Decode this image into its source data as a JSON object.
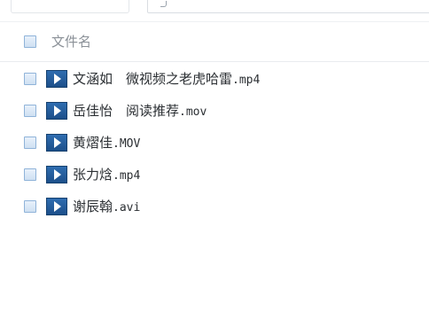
{
  "header": {
    "name_column": "文件名"
  },
  "files": [
    {
      "name": "文涵如　微视频之老虎哈雷",
      "ext": ".mp4",
      "icon": "video-play-icon"
    },
    {
      "name": "岳佳怡　阅读推荐",
      "ext": ".mov",
      "icon": "video-play-icon"
    },
    {
      "name": "黄熠佳",
      "ext": ".MOV",
      "icon": "video-play-icon"
    },
    {
      "name": "张力焓",
      "ext": ".mp4",
      "icon": "video-play-icon"
    },
    {
      "name": "谢辰翰",
      "ext": ".avi",
      "icon": "video-play-icon"
    }
  ],
  "colors": {
    "icon_blue": "#2f6db0",
    "checkbox_border": "#8fb3d9",
    "header_text": "#8a9097",
    "file_text": "#2b2f33"
  }
}
